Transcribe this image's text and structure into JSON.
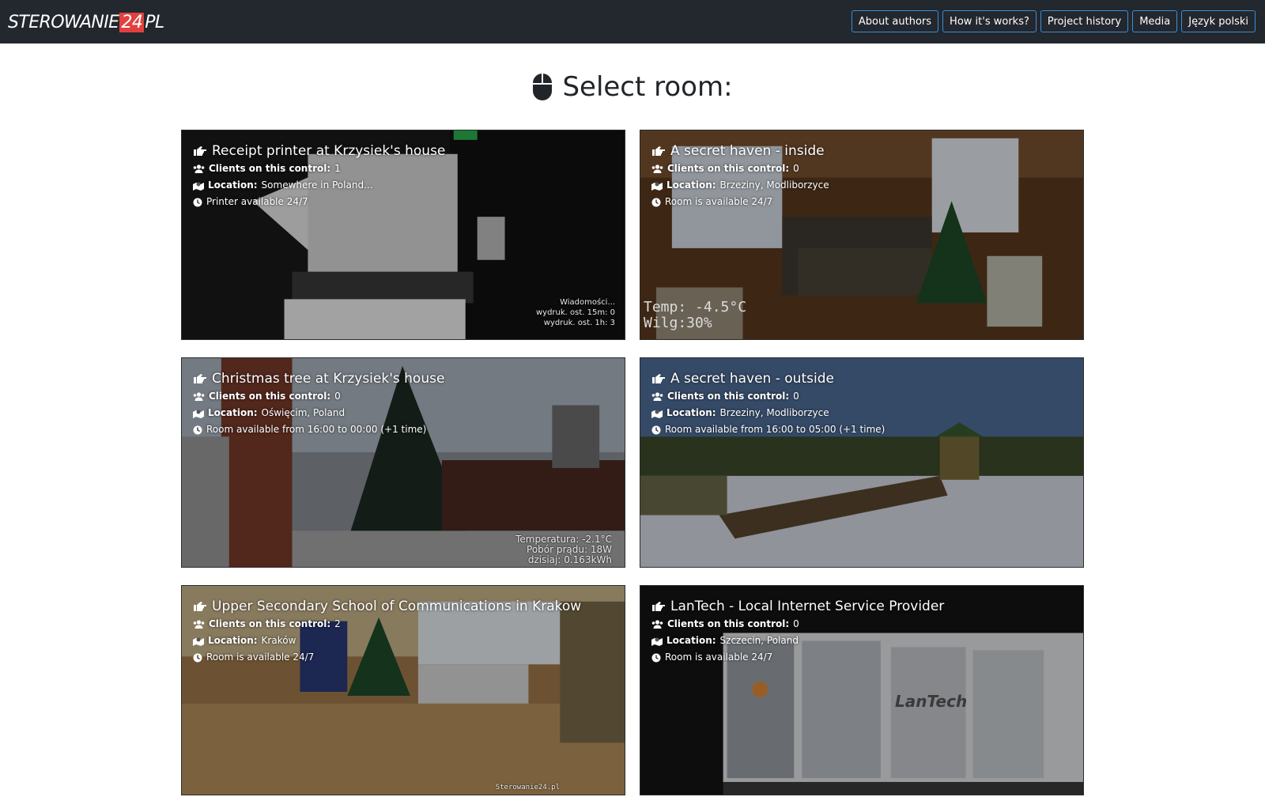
{
  "brand": {
    "left": "STEROWANIE",
    "num": "24",
    "right": "PL"
  },
  "nav": [
    "About authors",
    "How it's works?",
    "Project history",
    "Media",
    "Język polski"
  ],
  "heading": "Select room:",
  "labels": {
    "clients": "Clients on this control:",
    "location": "Location:"
  },
  "rooms": [
    {
      "title": "Receipt printer at Krzysiek's house",
      "clients": "1",
      "location": "Somewhere in Poland...",
      "availability": "Printer available 24/7",
      "overlay": [
        "Wiadomości...",
        "wydruk. ost. 15m: 0",
        "wydruk. ost. 1h: 3"
      ]
    },
    {
      "title": "A secret haven - inside",
      "clients": "0",
      "location": "Brzeziny, Modliborzyce",
      "availability": "Room is available 24/7",
      "overlay": [
        "Temp: -4.5°C",
        "Wilg:30%"
      ]
    },
    {
      "title": "Christmas tree at Krzysiek's house",
      "clients": "0",
      "location": "Oświęcim, Poland",
      "availability": "Room available from 16:00 to 00:00 (+1 time)",
      "overlay": [
        "Temperatura: -2.1°C",
        "Pobór prądu: 18W",
        "dzisiaj: 0.163kWh"
      ]
    },
    {
      "title": "A secret haven - outside",
      "clients": "0",
      "location": "Brzeziny, Modliborzyce",
      "availability": "Room available from 16:00 to 05:00 (+1 time)",
      "overlay": []
    },
    {
      "title": "Upper Secondary School of Communications in Krakow",
      "clients": "2",
      "location": "Kraków",
      "availability": "Room is available 24/7",
      "overlay": [
        "Sterowanie24.pl"
      ]
    },
    {
      "title": "LanTech - Local Internet Service Provider",
      "clients": "0",
      "location": "Szczecin, Poland",
      "availability": "Room is available 24/7",
      "overlay": [
        "LanTech"
      ]
    }
  ],
  "colors": {
    "navbar": "#23272e",
    "nav_border": "#3a8fd6",
    "brand_accent": "#e0413f"
  }
}
